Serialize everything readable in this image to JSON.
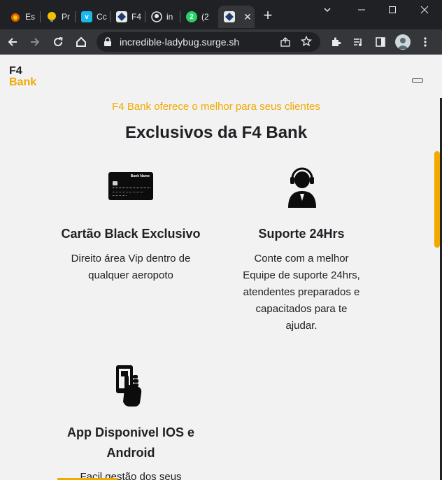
{
  "browser": {
    "tabs": [
      {
        "label": "Es",
        "icon": "firefox-icon",
        "color": "#e66000"
      },
      {
        "label": "Pr",
        "icon": "bulb-icon",
        "color": "#f2c200"
      },
      {
        "label": "Cc",
        "icon": "vimeo-icon",
        "color": "#1ab7ea"
      },
      {
        "label": "F4",
        "icon": "f4-bank-icon",
        "color": "#1f3a6b"
      },
      {
        "label": "in",
        "icon": "github-icon",
        "color": "#ffffff"
      },
      {
        "label": "(2",
        "icon": "whatsapp-icon",
        "color": "#25d366",
        "badge": "2"
      }
    ],
    "active_tab_icon": "f4-bank-icon",
    "new_tab_symbol": "+",
    "url": "incredible-ladybug.surge.sh"
  },
  "page": {
    "logo_line1": "F4",
    "logo_line2": "Bank",
    "tagline": "F4 Bank oferece o melhor para seus clientes",
    "heading": "Exclusivos da F4 Bank",
    "card_bank_name": "Bank Name",
    "features": [
      {
        "icon": "credit-card-icon",
        "title": "Cartão Black Exclusivo",
        "desc_lines": [
          "Direito área Vip dentro de",
          "qualquer aeropoto"
        ]
      },
      {
        "icon": "headset-support-icon",
        "title": "Suporte 24Hrs",
        "desc_lines": [
          "Conte com a melhor",
          "Equipe de suporte 24hrs,",
          "atendentes preparados e",
          "capacitados para te",
          "ajudar."
        ]
      },
      {
        "icon": "phone-hand-icon",
        "title_lines": [
          "App Disponivel IOS e",
          "Android"
        ],
        "desc_lines": [
          "Facil gestão dos seus"
        ]
      }
    ]
  },
  "colors": {
    "accent": "#f2a900",
    "text": "#202124",
    "page_bg": "#f2f2f2",
    "chrome_bg": "#202124"
  }
}
